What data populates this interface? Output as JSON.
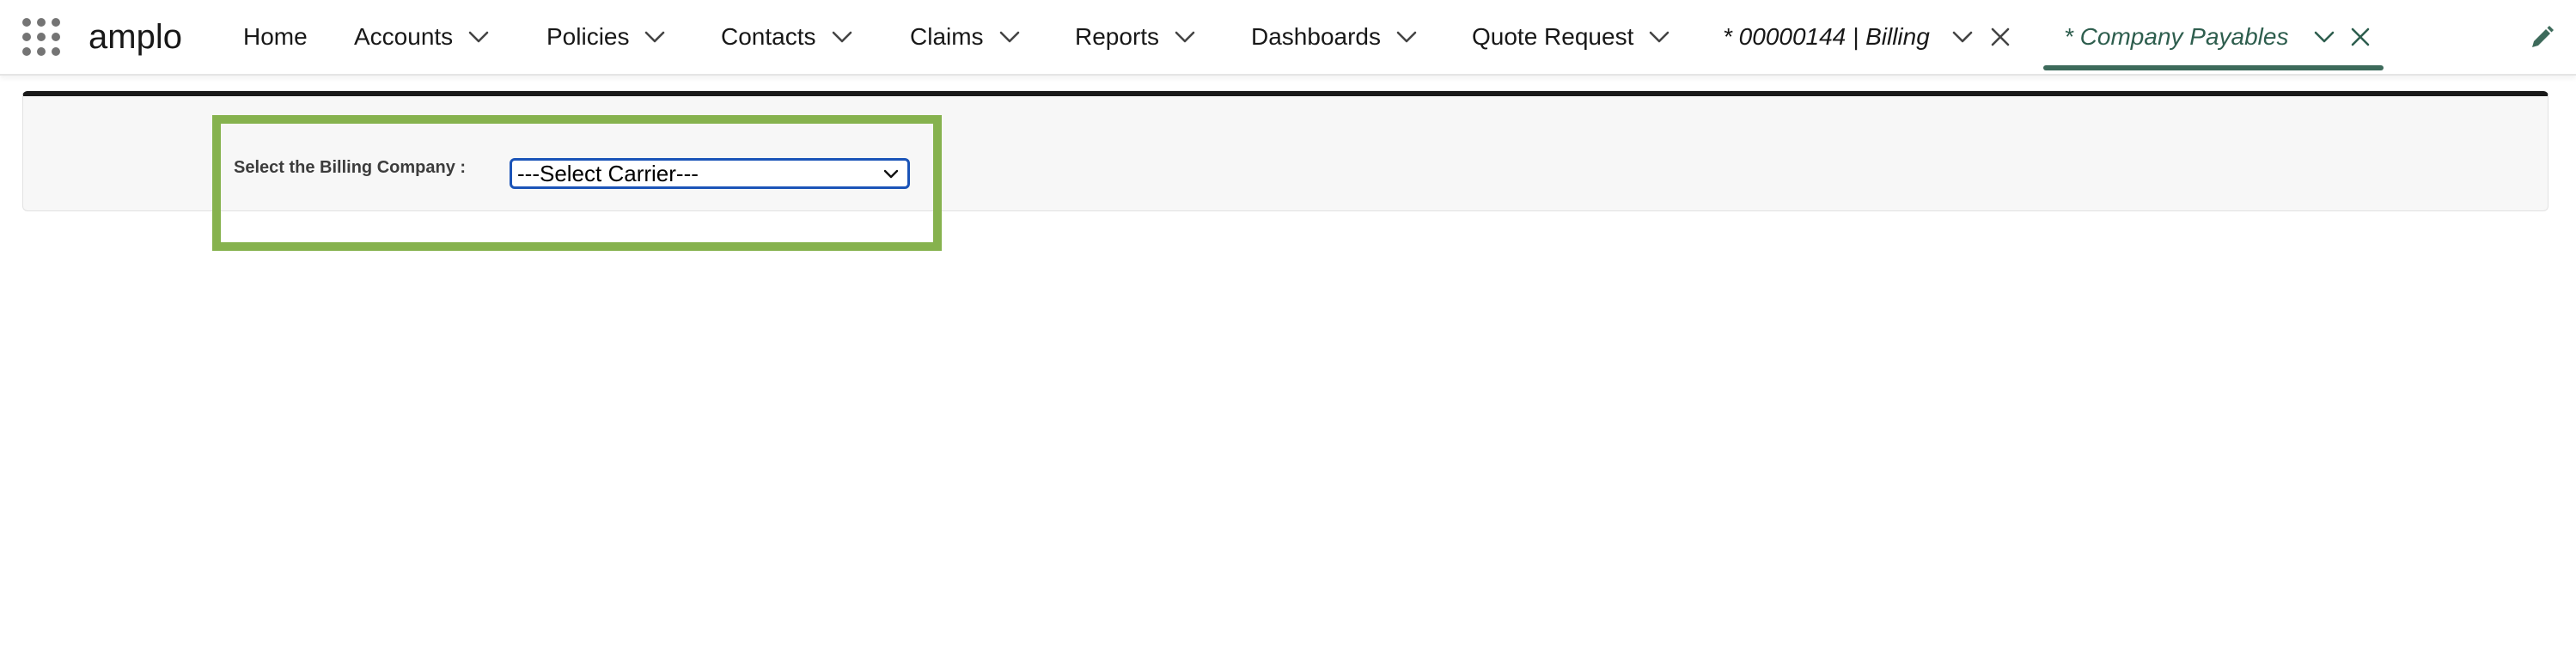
{
  "app": {
    "name": "amplo",
    "launcher_icon": "app-launcher-grid-icon"
  },
  "nav": {
    "items": [
      {
        "label": "Home"
      },
      {
        "label": "Accounts"
      },
      {
        "label": "Policies"
      },
      {
        "label": "Contacts"
      },
      {
        "label": "Claims"
      },
      {
        "label": "Reports"
      },
      {
        "label": "Dashboards"
      },
      {
        "label": "Quote Request"
      }
    ],
    "workspace_tabs": [
      {
        "label": "* 00000144 | Billing",
        "active": false
      },
      {
        "label": "* Company Payables",
        "active": true
      }
    ],
    "edit_icon": "pencil-icon"
  },
  "form": {
    "label": "Select the Billing Company :",
    "select": {
      "selected": "---Select Carrier---"
    }
  },
  "colors": {
    "highlight": "#86b24e",
    "active_tab": "#3d6a5b",
    "select_border": "#1b54b8",
    "panel_top_border": "#1a1a1a"
  }
}
